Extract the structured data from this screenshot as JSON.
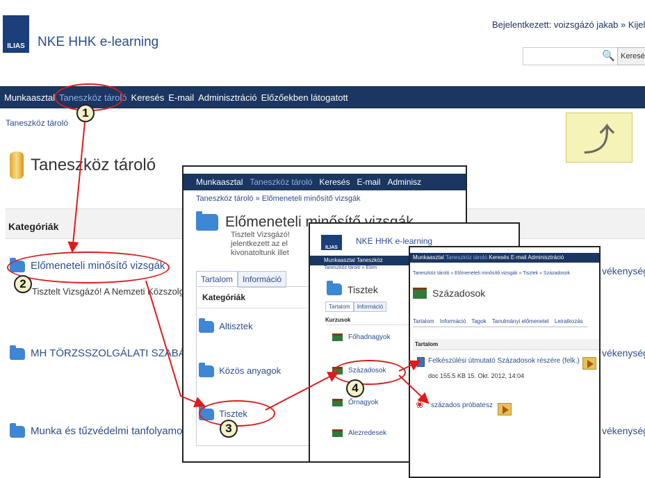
{
  "header": {
    "logo": "ILIAS",
    "title": "NKE HHK e-learning",
    "user_line": "Bejelentkezett: voizsgázó jakab » Kijelentkez",
    "search_button": "Keresés"
  },
  "nav": [
    "Munkaasztal",
    "Taneszköz tároló",
    "Keresés",
    "E-mail",
    "Adminisztráció",
    "Előzőekben látogatott"
  ],
  "breadcrumb": "Taneszköz tároló",
  "page_title": "Taneszköz tároló",
  "categories": {
    "heading": "Kategóriák",
    "items": [
      {
        "label": "Előmeneteli minősítő vizsgák",
        "desc": "Tisztelt Vizsgázó! A Nemzeti Közszolgálati"
      },
      {
        "label": "MH TÖRZSSZOLGÁLATI SZABÁLYZATA"
      },
      {
        "label": "Munka és tűzvédelmi tanfolyamok"
      }
    ],
    "right_text": "vékenysége"
  },
  "panel1": {
    "nav": [
      "Munkaasztal",
      "Taneszköz tároló",
      "Keresés",
      "E-mail",
      "Adminisz"
    ],
    "breadcrumb": "Taneszköz tároló » Előmeneteli minősítő vizsgák",
    "title": "Előmeneteli minősítő vizsgák",
    "desc": "Tisztelt Vizsgázó! jelentkezett az el kivonatoltunk illet",
    "tabs": [
      "Tartalom",
      "Információ"
    ],
    "cat_heading": "Kategóriák",
    "items": [
      "Altisztek",
      "Közös anyagok",
      "Tisztek"
    ]
  },
  "panel2": {
    "logo": "ILIAS",
    "title": "NKE HHK e-learning",
    "nav": "Munkaasztal Taneszköz",
    "breadcrumb": "Taneszköz tároló » Előm",
    "heading": "Tisztek",
    "tabs": [
      "Tartalom",
      "Információ"
    ],
    "courses_heading": "Kurzusok",
    "courses": [
      "Főhadnagyok",
      "Századosok",
      "Őrnagyok",
      "Alezredesek"
    ]
  },
  "panel3": {
    "nav": [
      "Munkaasztal",
      "Taneszköz tároló",
      "Keresés",
      "E-mail",
      "Adminisztráció"
    ],
    "breadcrumb": "Taneszköz tároló » Előmeneteli minősítő vizsgák » Tisztek » Századosok",
    "heading": "Századosok",
    "tabs": [
      "Tartalom",
      "Információ",
      "Tagok",
      "Tanulmányi előmenetel",
      "Leiratkozás"
    ],
    "content_heading": "Tartalom",
    "file_title": "Felkészülési útmutató Századosok részére (felk.)",
    "file_meta": "doc   155.5 KB   15. Okt. 2012, 14:04",
    "test_title": "százados próbatesz"
  },
  "markers": [
    "1",
    "2",
    "3",
    "4"
  ],
  "colors": {
    "nav_bg": "#1a3661",
    "link": "#2b4c8c",
    "annotation": "#e01a1a"
  }
}
